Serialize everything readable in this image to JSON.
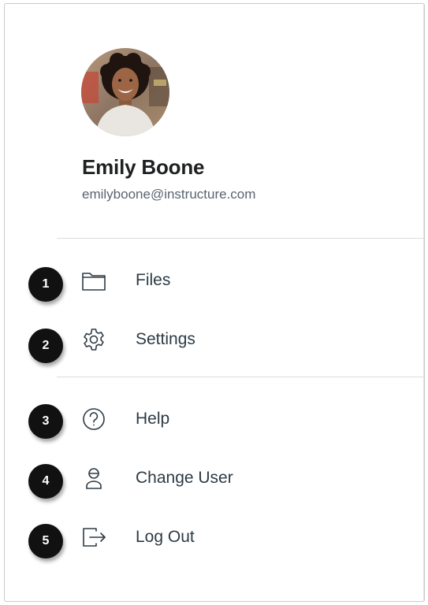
{
  "profile": {
    "name": "Emily Boone",
    "email": "emilyboone@instructure.com",
    "avatar_icon": "user-photo-avatar"
  },
  "menu": {
    "groups": [
      [
        {
          "label": "Files",
          "icon": "folder-icon",
          "callout": "1"
        },
        {
          "label": "Settings",
          "icon": "gear-icon",
          "callout": "2"
        }
      ],
      [
        {
          "label": "Help",
          "icon": "question-circle-icon",
          "callout": "3"
        },
        {
          "label": "Change User",
          "icon": "change-user-icon",
          "callout": "4"
        },
        {
          "label": "Log Out",
          "icon": "logout-icon",
          "callout": "5"
        }
      ]
    ]
  },
  "colors": {
    "text_primary": "#2d3b45",
    "text_secondary": "#5a6470",
    "callout_bg": "#111111",
    "divider": "#dcdcdc"
  }
}
